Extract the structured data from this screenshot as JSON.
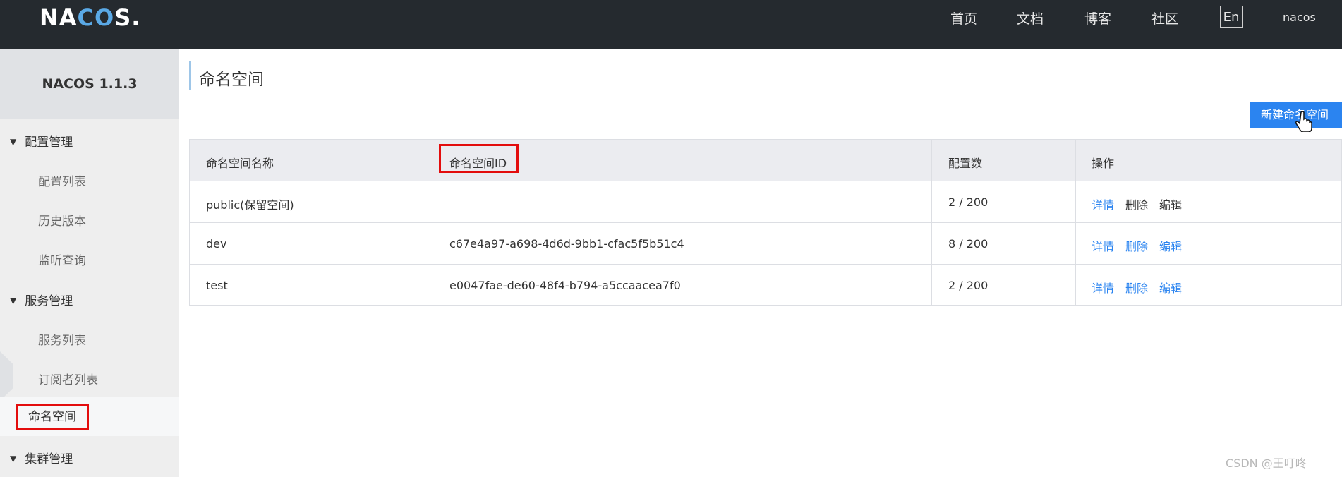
{
  "topbar": {
    "logo": {
      "pre": "NA",
      "mid": "CO",
      "post": "S."
    },
    "nav": [
      "首页",
      "文档",
      "博客",
      "社区"
    ],
    "lang": "En",
    "user": "nacos"
  },
  "sidebar": {
    "version": "NACOS 1.1.3",
    "groups": [
      {
        "label": "配置管理",
        "items": [
          "配置列表",
          "历史版本",
          "监听查询"
        ]
      },
      {
        "label": "服务管理",
        "items": [
          "服务列表",
          "订阅者列表"
        ]
      }
    ],
    "active_item": "命名空间",
    "last_group": "集群管理"
  },
  "main": {
    "title": "命名空间",
    "new_button": "新建命名空间",
    "columns": [
      "命名空间名称",
      "命名空间ID",
      "配置数",
      "操作"
    ],
    "rows": [
      {
        "name": "public(保留空间)",
        "id": "",
        "count": "2 / 200"
      },
      {
        "name": "dev",
        "id": "c67e4a97-a698-4d6d-9bb1-cfac5f5b51c4",
        "count": "8 / 200"
      },
      {
        "name": "test",
        "id": "e0047fae-de60-48f4-b794-a5ccaacea7f0",
        "count": "2 / 200"
      }
    ],
    "ops": {
      "detail": "详情",
      "delete": "删除",
      "edit": "编辑"
    }
  },
  "watermark": "CSDN @王叮咚",
  "colors": {
    "accent": "#2b84f0",
    "topbar": "#252a2f",
    "highlight": "#e30d0d"
  }
}
